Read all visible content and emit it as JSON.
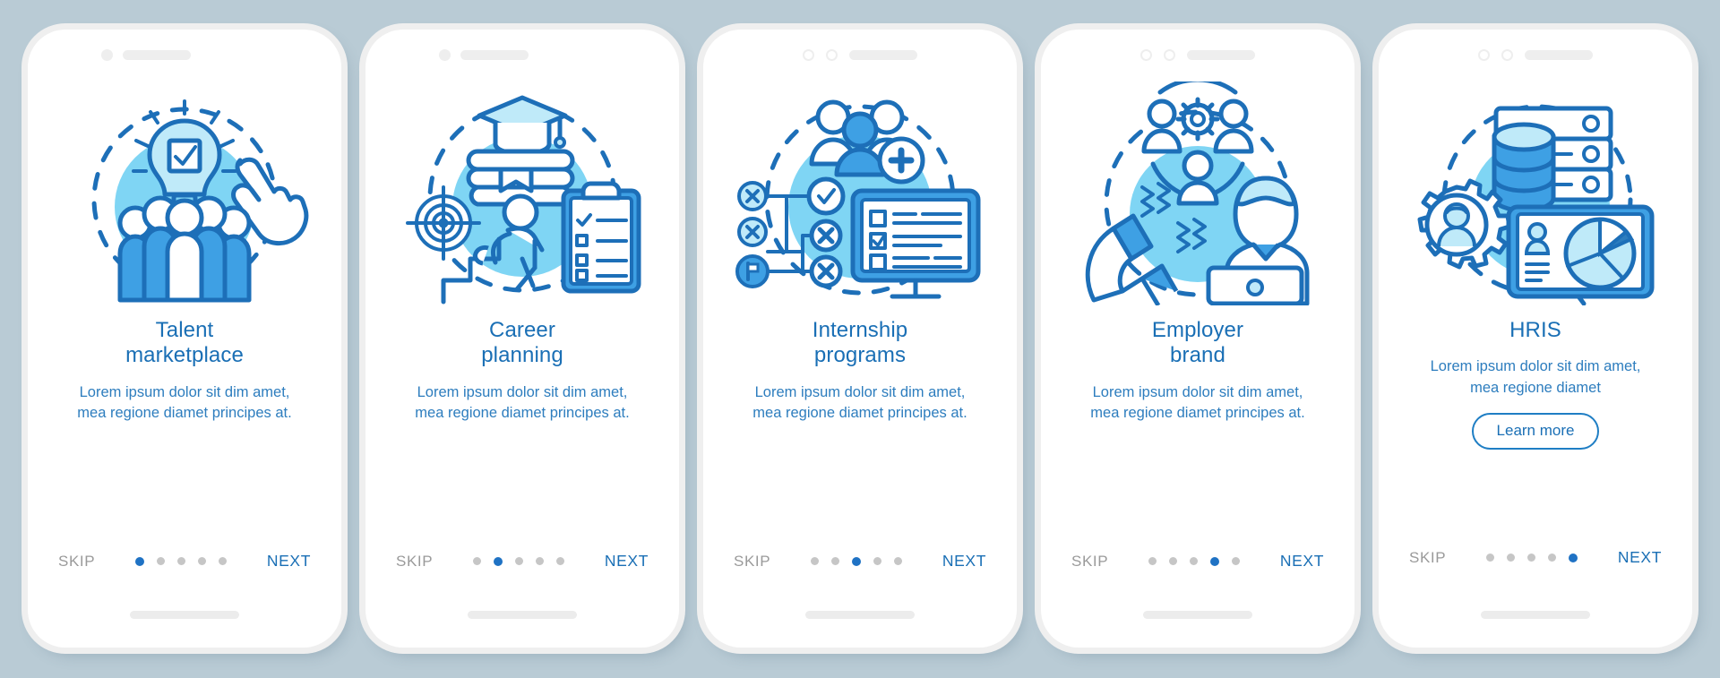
{
  "meta": {
    "background_color": "#b9cbd5",
    "card_color": "#ffffff",
    "accent_color": "#1a6fb5",
    "body_text_color": "#2d7dbe",
    "muted_color": "#9a9a9a",
    "dot_active_color": "#1f72c4",
    "dot_inactive_color": "#c6c6c6",
    "illustration_blob_color": "#7fd5f4",
    "illustration_line_color": "#1d6fb8",
    "total_screens": 5
  },
  "common": {
    "skip_label": "SKIP",
    "next_label": "NEXT",
    "body_text": "Lorem ipsum dolor sit dim amet, mea regione diamet principes at.",
    "body_text_short": "Lorem ipsum dolor sit dim amet, mea regione diamet"
  },
  "screens": [
    {
      "index": 1,
      "title": "Talent\nmarketplace",
      "title_line1": "Talent",
      "title_line2": "marketplace",
      "body": "Lorem ipsum dolor sit dim amet, mea regione diamet principes at.",
      "skip_label": "SKIP",
      "next_label": "NEXT",
      "active_dot": 1,
      "has_learn_more": false,
      "illustration": "lightbulb-checkmark-people-cursor-icon",
      "notch_style": "single-dot"
    },
    {
      "index": 2,
      "title": "Career\nplanning",
      "title_line1": "Career",
      "title_line2": "planning",
      "body": "Lorem ipsum dolor sit dim amet, mea regione diamet principes at.",
      "skip_label": "SKIP",
      "next_label": "NEXT",
      "active_dot": 2,
      "has_learn_more": false,
      "illustration": "graduation-cap-books-target-stairs-checklist-icon",
      "notch_style": "single-dot"
    },
    {
      "index": 3,
      "title": "Internship\nprograms",
      "title_line1": "Internship",
      "title_line2": "programs",
      "body": "Lorem ipsum dolor sit dim amet, mea regione diamet principes at.",
      "skip_label": "SKIP",
      "next_label": "NEXT",
      "active_dot": 3,
      "has_learn_more": false,
      "illustration": "group-people-plus-flowchart-monitor-checklist-icon",
      "notch_style": "double-ring"
    },
    {
      "index": 4,
      "title": "Employer\nbrand",
      "title_line1": "Employer",
      "title_line2": "brand",
      "body": "Lorem ipsum dolor sit dim amet, mea regione diamet principes at.",
      "skip_label": "SKIP",
      "next_label": "NEXT",
      "active_dot": 4,
      "has_learn_more": false,
      "illustration": "people-gear-network-magnet-person-laptop-icon",
      "notch_style": "double-ring"
    },
    {
      "index": 5,
      "title": "HRIS",
      "title_line1": "HRIS",
      "title_line2": "",
      "body": "Lorem ipsum dolor sit dim amet, mea regione diamet",
      "learn_more_label": "Learn more",
      "skip_label": "SKIP",
      "next_label": "NEXT",
      "active_dot": 5,
      "has_learn_more": true,
      "illustration": "database-server-gear-avatar-monitor-piechart-icon",
      "notch_style": "double-ring"
    }
  ]
}
